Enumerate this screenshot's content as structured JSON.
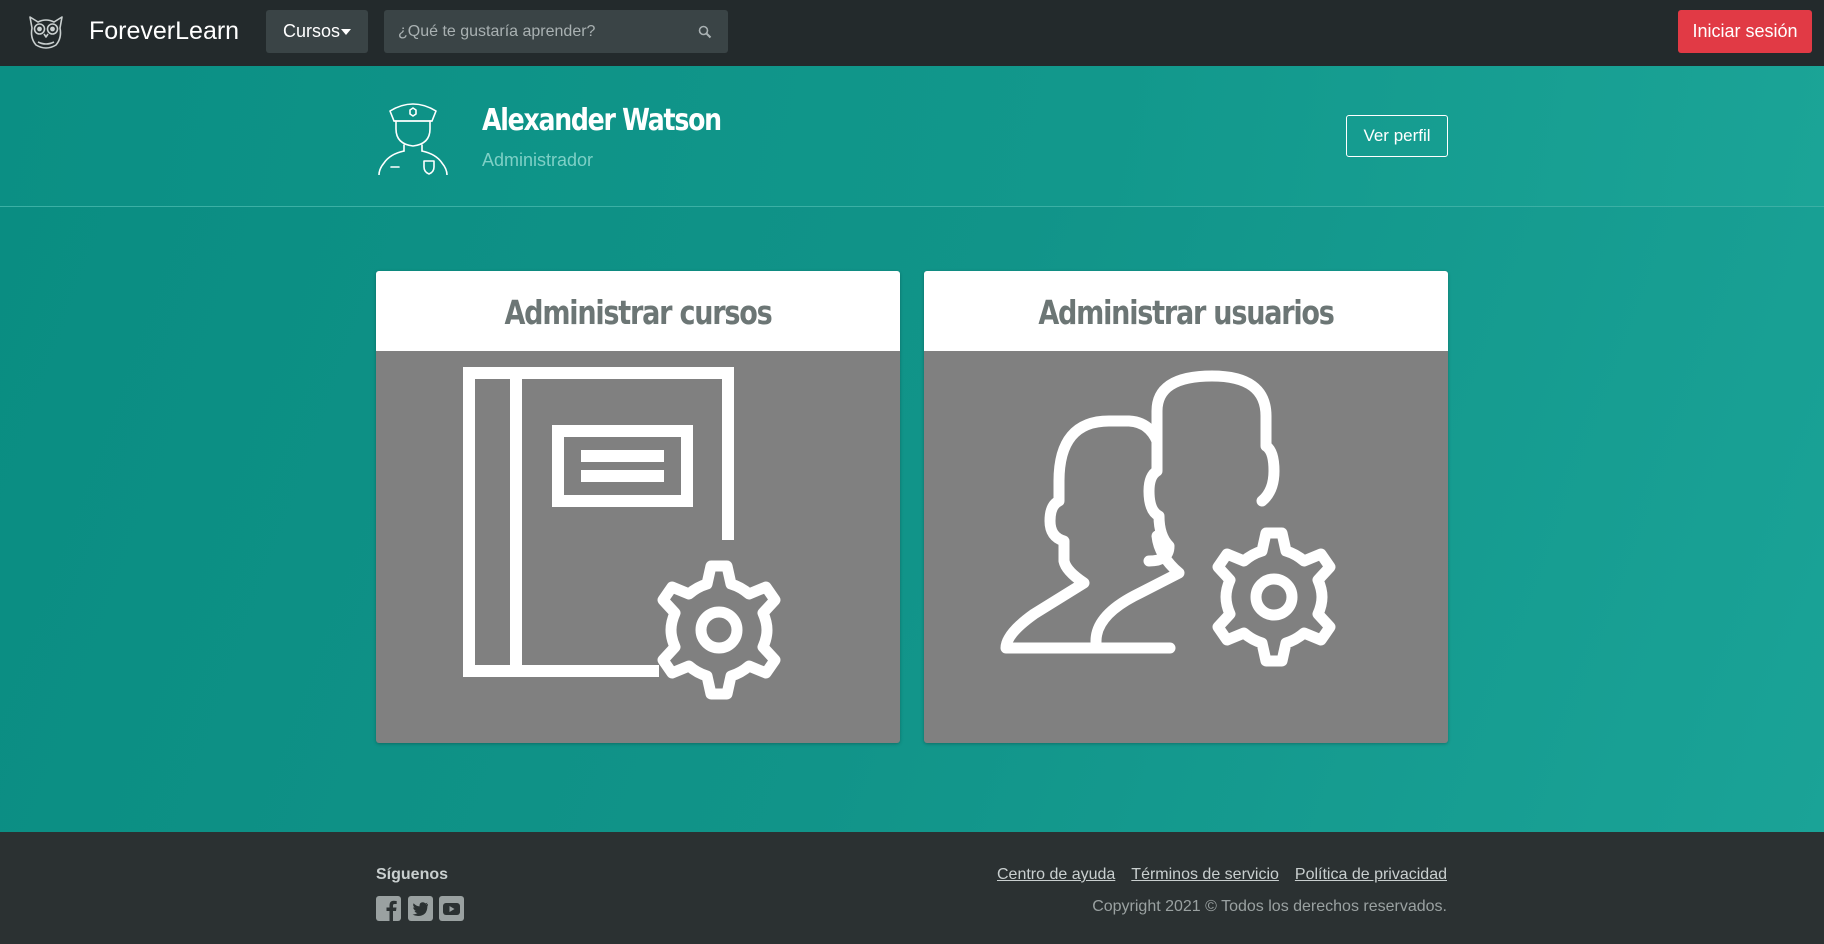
{
  "navbar": {
    "logo_icon": "owl-icon",
    "brand": "ForeverLearn",
    "courses_menu_label": "Cursos",
    "search_placeholder": "¿Qué te gustaría aprender?",
    "search_icon": "search-icon",
    "login_label": "Iniciar sesión"
  },
  "profile": {
    "avatar_icon": "police-officer-icon",
    "name": "Alexander Watson",
    "role": "Administrador",
    "view_profile_label": "Ver perfil"
  },
  "cards": [
    {
      "title": "Administrar cursos",
      "icon": "book-settings-icon"
    },
    {
      "title": "Administrar usuarios",
      "icon": "users-settings-icon"
    }
  ],
  "footer": {
    "follow_label": "Síguenos",
    "social_icons": [
      "facebook-icon",
      "twitter-icon",
      "youtube-icon"
    ],
    "links": [
      "Centro de ayuda",
      "Términos de servicio",
      "Política de privacidad"
    ],
    "copyright": "Copyright 2021 © Todos los derechos reservados."
  },
  "colors": {
    "navbar_bg": "#232a2c",
    "accent_teal": "#0f9488",
    "login_red": "#e13a45",
    "card_gray": "#808080",
    "footer_bg": "#2b3132"
  }
}
